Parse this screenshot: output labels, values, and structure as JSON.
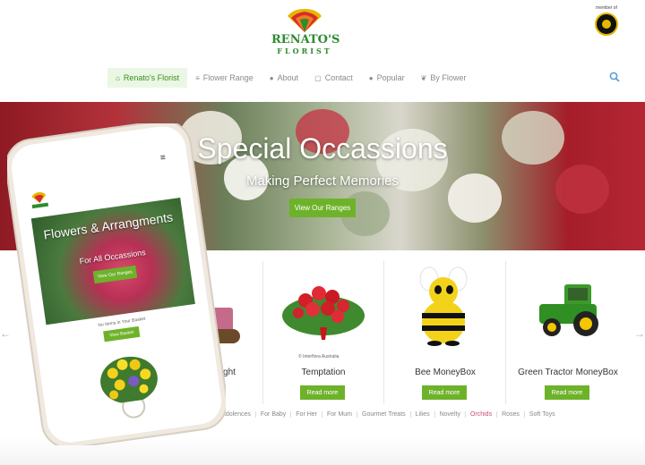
{
  "header": {
    "logo_text": "RENATO'S",
    "logo_sub": "FLORIST",
    "member_label": "member of"
  },
  "nav": {
    "items": [
      {
        "label": "Renato's Florist",
        "icon": "home-icon",
        "active": true
      },
      {
        "label": "Flower Range",
        "icon": "list-icon",
        "active": false
      },
      {
        "label": "About",
        "icon": "users-icon",
        "active": false
      },
      {
        "label": "Contact",
        "icon": "contact-icon",
        "active": false
      },
      {
        "label": "Popular",
        "icon": "person-icon",
        "active": false
      },
      {
        "label": "By Flower",
        "icon": "leaf-icon",
        "active": false
      }
    ]
  },
  "hero": {
    "title": "Special Occassions",
    "subtitle": "Making Perfect Memories",
    "button": "View Our Ranges"
  },
  "products": [
    {
      "name": "ght",
      "button": "Read more"
    },
    {
      "name": "Temptation",
      "button": "Read more",
      "credit": "© Interflora Australia"
    },
    {
      "name": "Bee MoneyBox",
      "button": "Read more"
    },
    {
      "name": "Green Tractor MoneyBox",
      "button": "Read more"
    }
  ],
  "categories": [
    "Condolences",
    "For Baby",
    "For Her",
    "For Mum",
    "Gourmet Treats",
    "Lilies",
    "Novelty",
    "Orchids",
    "Roses",
    "Soft Toys"
  ],
  "phone": {
    "hero_title": "Flowers & Arrangments",
    "hero_sub": "For All Occassions",
    "hero_button": "View Our Ranges",
    "basket_text": "No Items in Your Basket",
    "basket_button": "View Basket"
  },
  "colors": {
    "accent_green": "#6eb22a",
    "logo_green": "#2e8b2e",
    "nav_active_bg": "#eaf7e4"
  }
}
